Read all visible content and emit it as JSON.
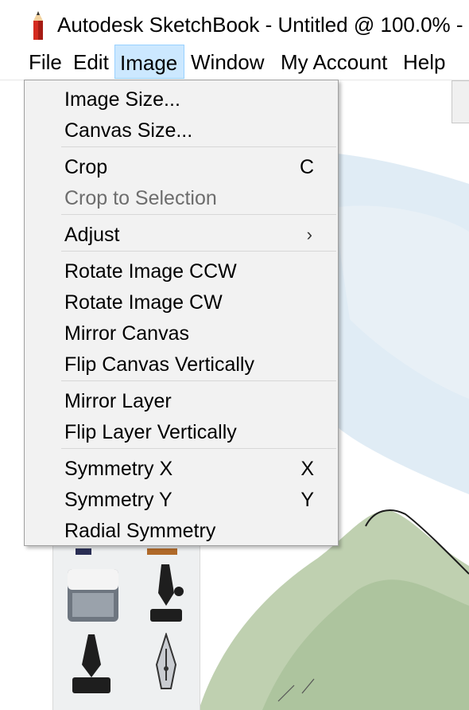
{
  "window": {
    "title": "Autodesk SketchBook - Untitled @ 100.0% -",
    "icon": "pencil-icon"
  },
  "menubar": {
    "items": [
      {
        "label": "File"
      },
      {
        "label": "Edit"
      },
      {
        "label": "Image",
        "active": true
      },
      {
        "label": "Window"
      },
      {
        "label": "My Account"
      },
      {
        "label": "Help"
      }
    ]
  },
  "image_menu": {
    "items": [
      {
        "label": "Image Size..."
      },
      {
        "label": "Canvas Size..."
      },
      {
        "label": "Crop",
        "shortcut": "C"
      },
      {
        "label": "Crop to Selection",
        "disabled": true
      },
      {
        "label": "Adjust",
        "submenu": true
      },
      {
        "label": "Rotate Image CCW"
      },
      {
        "label": "Rotate Image CW"
      },
      {
        "label": "Mirror Canvas"
      },
      {
        "label": "Flip Canvas Vertically"
      },
      {
        "label": "Mirror Layer"
      },
      {
        "label": "Flip Layer Vertically"
      },
      {
        "label": "Symmetry X",
        "shortcut": "X"
      },
      {
        "label": "Symmetry Y",
        "shortcut": "Y"
      },
      {
        "label": "Radial Symmetry"
      }
    ]
  },
  "brush_palette": {
    "tools": [
      "eraser-icon",
      "ink-pen-icon",
      "calligraphy-pen-icon",
      "fountain-pen-icon"
    ]
  },
  "colors": {
    "menu_active_bg": "#cce8ff",
    "menu_bg": "#f2f2f2",
    "disabled_text": "#6d6d6d"
  }
}
